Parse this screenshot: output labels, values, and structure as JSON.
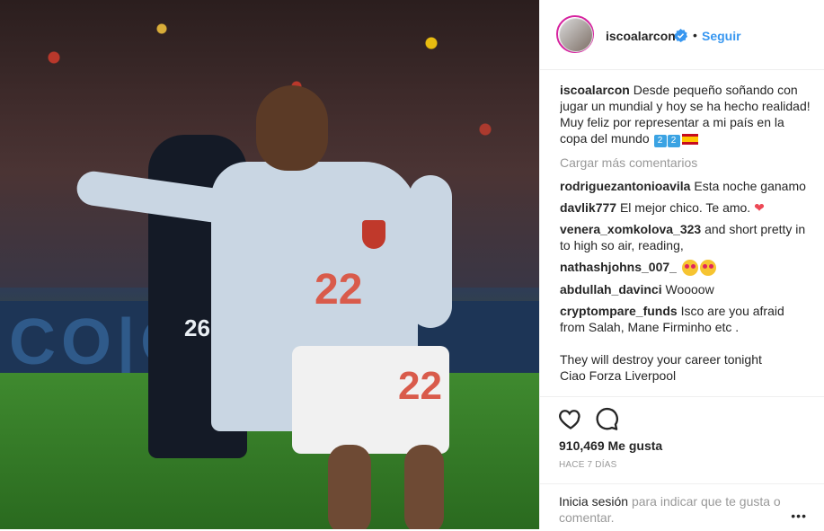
{
  "photo": {
    "banner_text": "CO|O",
    "shirt_number": "22",
    "opponent_number": "26"
  },
  "header": {
    "username": "iscoalarcon",
    "follow_label": "Seguir"
  },
  "caption": {
    "username": "iscoalarcon",
    "text": "Desde pequeño soñando con jugar un mundial y hoy se ha hecho realidad! Muy feliz por representar a mi país en la copa del mundo"
  },
  "load_more": "Cargar más comentarios",
  "comments": [
    {
      "user": "rodriguezantonioavila",
      "text": "Esta noche ganamo"
    },
    {
      "user": "davlik777",
      "text": "El mejor chico. Te amo."
    },
    {
      "user": "venera_xomkolova_323",
      "text": "and short pretty in to high so air, reading,"
    },
    {
      "user": "nathashjohns_007_",
      "text": ""
    },
    {
      "user": "abdullah_davinci",
      "text": "Woooow"
    },
    {
      "user": "cryptompare_funds",
      "text": "Isco are you afraid from Salah, Mane Firminho etc ."
    }
  ],
  "comment_extra": {
    "line1": "They will destroy your career tonight",
    "line2": "Ciao Forza Liverpool"
  },
  "likes": "910,469 Me gusta",
  "time": "HACE 7 DÍAS",
  "login": {
    "link": "Inicia sesión",
    "rest": "para indicar que te gusta o comentar."
  },
  "icons": {
    "like": "heart-outline-icon",
    "comment": "speech-bubble-icon",
    "more": "ellipsis-icon",
    "verified": "verified-badge-icon"
  },
  "colors": {
    "link_blue": "#3897f0",
    "text": "#262626",
    "muted": "#999999",
    "heart": "#ed4956"
  }
}
